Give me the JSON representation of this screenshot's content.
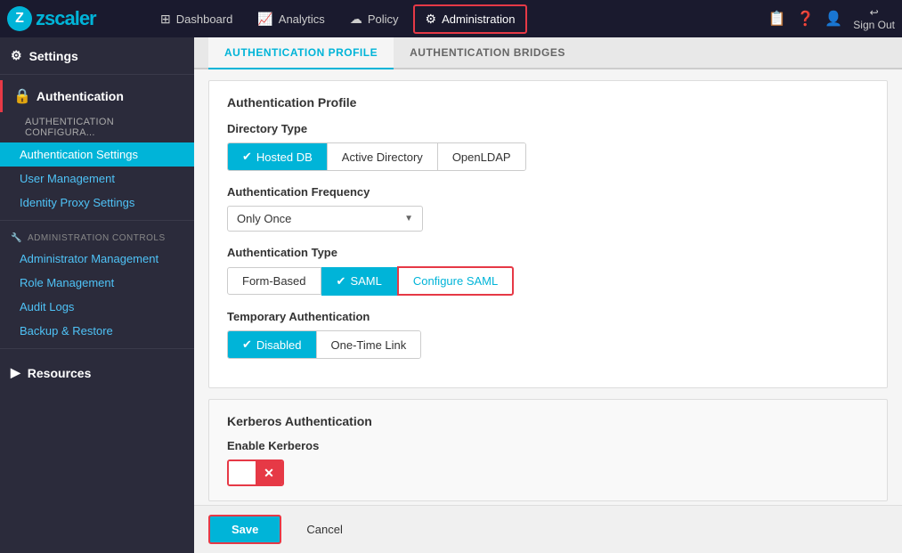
{
  "app": {
    "logo": "zscaler",
    "logo_z": "Z"
  },
  "topnav": {
    "items": [
      {
        "id": "dashboard",
        "label": "Dashboard",
        "icon": "⊞",
        "active": false
      },
      {
        "id": "analytics",
        "label": "Analytics",
        "icon": "📈",
        "active": false
      },
      {
        "id": "policy",
        "label": "Policy",
        "icon": "☁",
        "active": false
      },
      {
        "id": "administration",
        "label": "Administration",
        "icon": "⚙",
        "active": true
      }
    ],
    "right_icons": [
      "checklist",
      "help",
      "user",
      "signout"
    ],
    "signout_label": "Sign Out"
  },
  "sidebar": {
    "settings_label": "Settings",
    "authentication_label": "Authentication",
    "auth_config_label": "AUTHENTICATION CONFIGURA...",
    "auth_settings_label": "Authentication Settings",
    "user_management_label": "User Management",
    "identity_proxy_label": "Identity Proxy Settings",
    "admin_controls_label": "ADMINISTRATION CONTROLS",
    "administrator_mgmt_label": "Administrator Management",
    "role_mgmt_label": "Role Management",
    "audit_logs_label": "Audit Logs",
    "backup_restore_label": "Backup & Restore",
    "resources_label": "Resources"
  },
  "tabs": [
    {
      "id": "auth-profile",
      "label": "AUTHENTICATION PROFILE",
      "active": true
    },
    {
      "id": "auth-bridges",
      "label": "AUTHENTICATION BRIDGES",
      "active": false
    }
  ],
  "content": {
    "auth_profile_title": "Authentication Profile",
    "directory_type_label": "Directory Type",
    "directory_options": [
      {
        "id": "hosted-db",
        "label": "Hosted DB",
        "selected": true
      },
      {
        "id": "active-directory",
        "label": "Active Directory",
        "selected": false
      },
      {
        "id": "openldap",
        "label": "OpenLDAP",
        "selected": false
      }
    ],
    "auth_frequency_label": "Authentication Frequency",
    "auth_frequency_value": "Only Once",
    "auth_frequency_placeholder": "Only Once",
    "auth_type_label": "Authentication Type",
    "auth_type_options": [
      {
        "id": "form-based",
        "label": "Form-Based",
        "selected": false
      },
      {
        "id": "saml",
        "label": "SAML",
        "selected": true
      },
      {
        "id": "configure-saml",
        "label": "Configure SAML",
        "selected": false,
        "configure": true
      }
    ],
    "temp_auth_label": "Temporary Authentication",
    "temp_auth_options": [
      {
        "id": "disabled",
        "label": "Disabled",
        "selected": true
      },
      {
        "id": "one-time-link",
        "label": "One-Time Link",
        "selected": false
      }
    ],
    "kerberos_section_title": "Kerberos Authentication",
    "enable_kerberos_label": "Enable Kerberos",
    "kerberos_toggle": false
  },
  "footer": {
    "save_label": "Save",
    "cancel_label": "Cancel"
  },
  "icons": {
    "check": "✔",
    "arrow_down": "▼",
    "close": "✕",
    "gear": "⚙",
    "lock": "🔒",
    "wrench": "🔧",
    "dashboard": "⊞",
    "analytics": "📈",
    "policy": "☁",
    "checklist": "📋",
    "help": "?",
    "user": "👤",
    "signout": "↩"
  }
}
